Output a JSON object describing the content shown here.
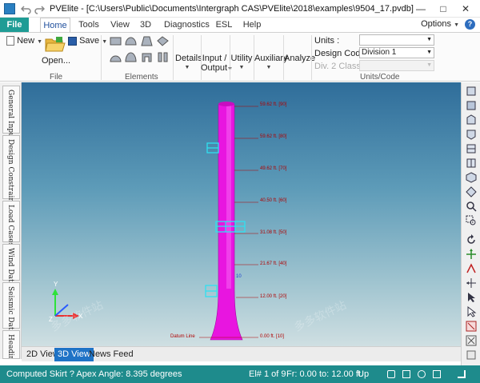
{
  "window": {
    "title": "PVElite - [C:\\Users\\Public\\Documents\\Intergraph CAS\\PVElite\\2018\\examples\\9504_17.pvdb]",
    "minimize_glyph": "—",
    "maximize_glyph": "□",
    "close_glyph": "✕"
  },
  "ribbon_tabs": [
    "File",
    "Home",
    "Tools",
    "View",
    "3D",
    "Diagnostics",
    "ESL",
    "Help"
  ],
  "options_label": "Options",
  "help_glyph": "?",
  "file_group": {
    "new_label": "New",
    "save_label": "Save",
    "open_label": "Open...",
    "group_label": "File"
  },
  "elements_group": {
    "group_label": "Elements"
  },
  "commands": {
    "details": "Details",
    "input_output_line1": "Input /",
    "input_output_line2": "Output",
    "utility": "Utility",
    "auxiliary": "Auxiliary",
    "analyze": "Analyze"
  },
  "units_group": {
    "units_label": "Units :",
    "units_value": "",
    "design_code_label": "Design Code :",
    "design_code_value": "Division 1",
    "div2_label": "Div. 2 Class:",
    "div2_value": "",
    "group_label": "Units/Code"
  },
  "left_tabs": [
    "General Input",
    "Design Constraints",
    "Load Cases",
    "Wind Data",
    "Seismic Data",
    "Heading"
  ],
  "elevation_labels": [
    {
      "text": "59.62 ft.",
      "node": "[90]"
    },
    {
      "text": "59.62 ft.",
      "node": "[80]"
    },
    {
      "text": "49.62 ft.",
      "node": "[70]"
    },
    {
      "text": "40.50 ft.",
      "node": "[60]"
    },
    {
      "text": "31.08 ft.",
      "node": "[50]"
    },
    {
      "text": "21.67 ft.",
      "node": "[40]"
    },
    {
      "text": "12.00 ft.",
      "node": "[20]"
    },
    {
      "text": "0.00 ft.",
      "node": "[10]"
    }
  ],
  "datum_label": "Datum Line",
  "node_marker": "10",
  "axis": {
    "x": "X",
    "y": "Y",
    "z": "Z"
  },
  "watermark": "多多软件站",
  "view_tabs": [
    "2D View",
    "3D View",
    "News Feed"
  ],
  "status_bar": {
    "message": "Computed Skirt ? Apex Angle:  8.395   degrees",
    "element": "El# 1 of 9",
    "range": "Fr: 0.00 to: 12.00 ft.",
    "direction": "Up"
  },
  "colors": {
    "accent": "#1f9c95",
    "vessel": "#e815e0",
    "status_bar": "#1e8b8c",
    "dimension_text": "#b00000"
  }
}
